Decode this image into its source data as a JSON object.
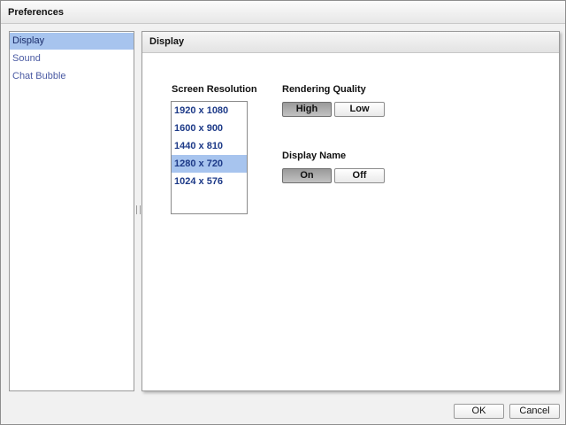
{
  "window": {
    "title": "Preferences"
  },
  "nav": {
    "items": [
      {
        "label": "Display",
        "selected": true
      },
      {
        "label": "Sound",
        "selected": false
      },
      {
        "label": "Chat Bubble",
        "selected": false
      }
    ]
  },
  "panel": {
    "title": "Display",
    "screen_resolution": {
      "label": "Screen Resolution",
      "options": [
        "1920 x 1080",
        "1600 x 900",
        "1440 x 810",
        "1280 x 720",
        "1024 x 576"
      ],
      "selected": "1280 x 720"
    },
    "rendering_quality": {
      "label": "Rendering Quality",
      "options": [
        "High",
        "Low"
      ],
      "selected": "High"
    },
    "display_name": {
      "label": "Display Name",
      "options": [
        "On",
        "Off"
      ],
      "selected": "On"
    }
  },
  "footer": {
    "ok_label": "OK",
    "cancel_label": "Cancel"
  },
  "colors": {
    "selection": "#a7c4ee",
    "nav_text": "#4a5aa3",
    "list_text": "#1d3a88"
  }
}
